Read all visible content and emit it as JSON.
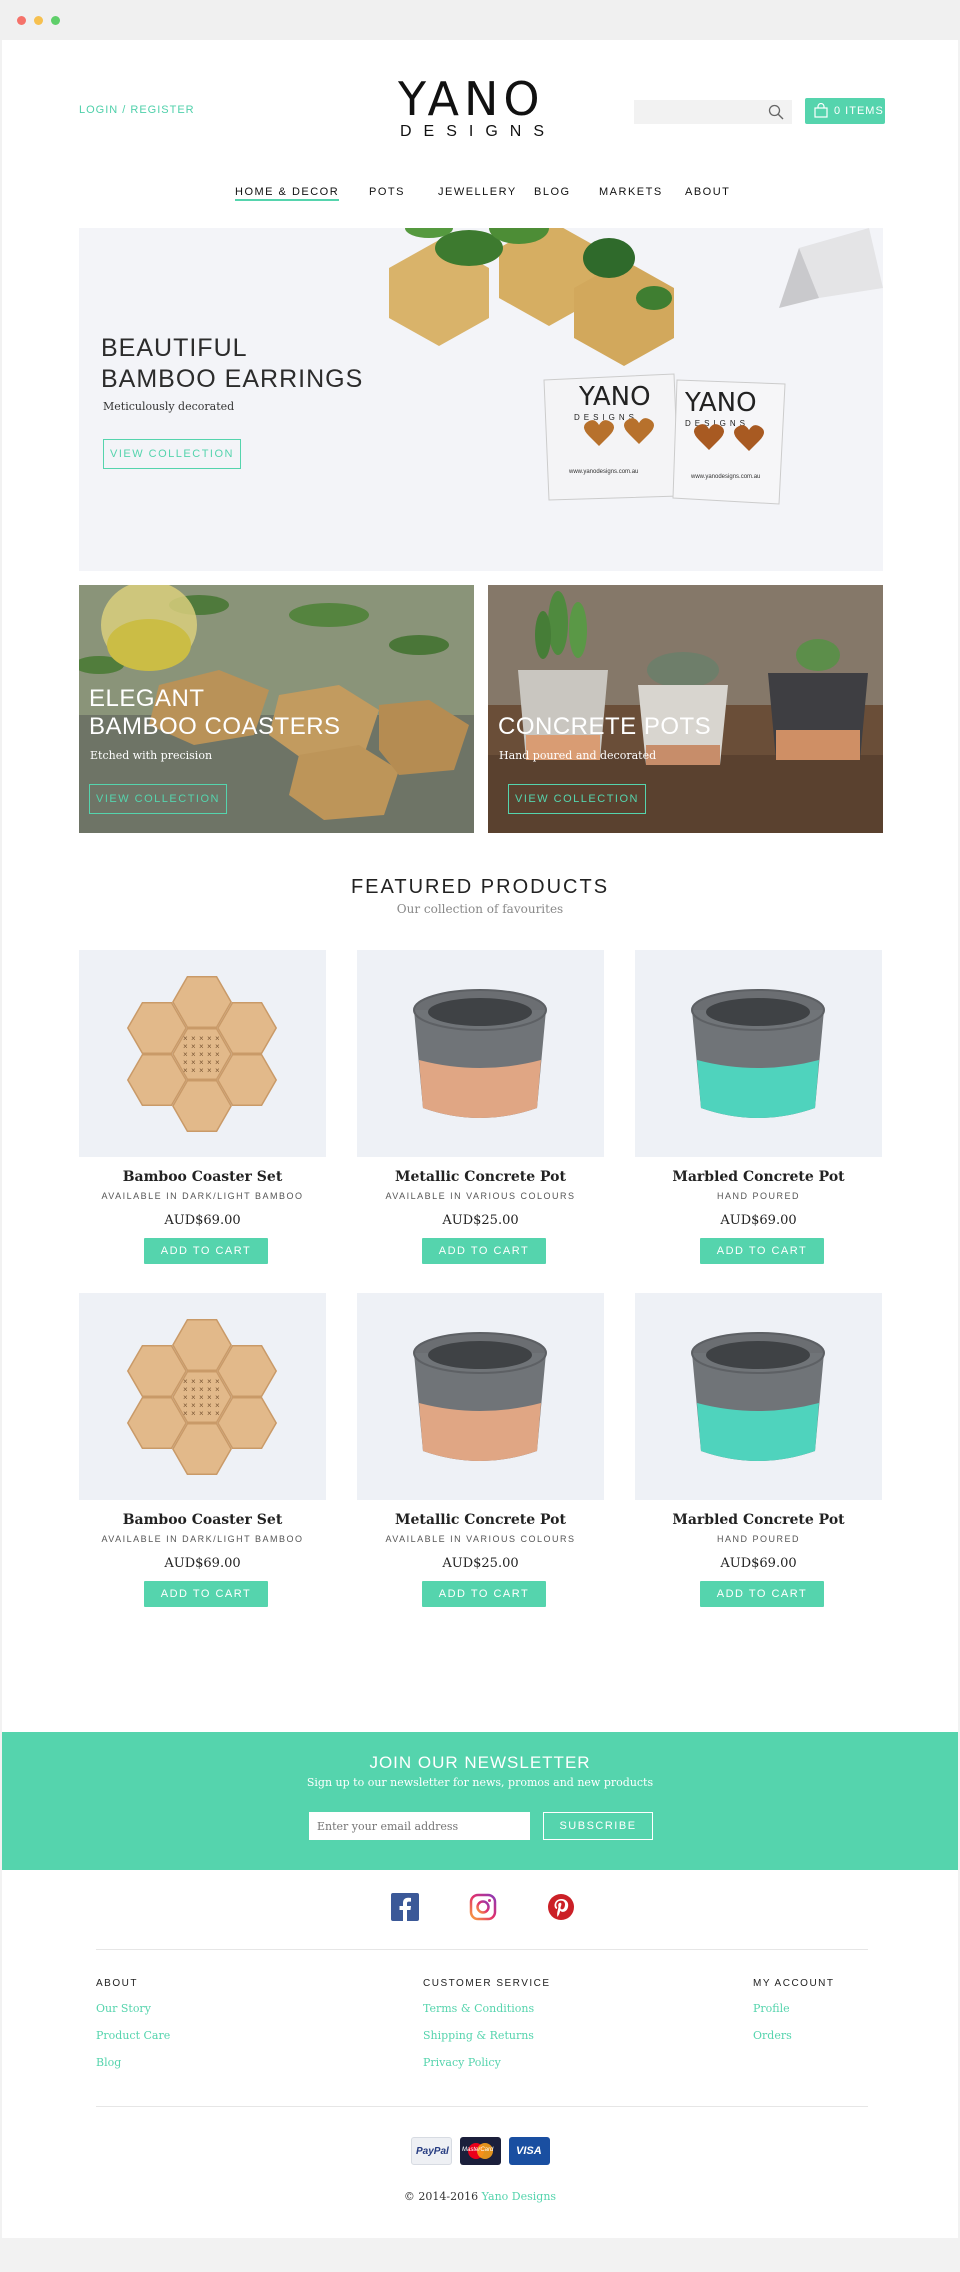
{
  "header": {
    "login_label": "LOGIN / REGISTER",
    "logo_top": "YANO",
    "logo_sub": "DESIGNS",
    "search_placeholder": "",
    "cart_label": "0 ITEMS"
  },
  "nav": [
    "HOME & DECOR",
    "POTS",
    "JEWELLERY",
    "BLOG",
    "MARKETS",
    "ABOUT"
  ],
  "hero": {
    "title_line1": "BEAUTIFUL",
    "title_line2": "BAMBOO EARRINGS",
    "subtitle": "Meticulously decorated",
    "button": "VIEW COLLECTION",
    "card_brand": "YANO",
    "card_brand_sub": "DESIGNS",
    "card_url": "www.yanodesigns.com.au"
  },
  "promos": [
    {
      "title_line1": "ELEGANT",
      "title_line2": "BAMBOO COASTERS",
      "subtitle": "Etched with precision",
      "button": "VIEW COLLECTION"
    },
    {
      "title_line1": "CONCRETE POTS",
      "subtitle": "Hand poured and decorated",
      "button": "VIEW COLLECTION"
    }
  ],
  "featured": {
    "title": "FEATURED PRODUCTS",
    "subtitle": "Our collection of favourites",
    "add_label": "ADD TO CART",
    "products": [
      {
        "name": "Bamboo Coaster Set",
        "note": "AVAILABLE IN DARK/LIGHT BAMBOO",
        "price": "AUD$69.00",
        "image": "hexagon-coaster-set"
      },
      {
        "name": "Metallic Concrete Pot",
        "note": "AVAILABLE IN VARIOUS COLOURS",
        "price": "AUD$25.00",
        "image": "concrete-pot-copper"
      },
      {
        "name": "Marbled Concrete Pot",
        "note": "HAND POURED",
        "price": "AUD$69.00",
        "image": "concrete-pot-teal"
      },
      {
        "name": "Bamboo Coaster Set",
        "note": "AVAILABLE IN DARK/LIGHT BAMBOO",
        "price": "AUD$69.00",
        "image": "hexagon-coaster-set"
      },
      {
        "name": "Metallic Concrete Pot",
        "note": "AVAILABLE IN VARIOUS COLOURS",
        "price": "AUD$25.00",
        "image": "concrete-pot-copper"
      },
      {
        "name": "Marbled Concrete Pot",
        "note": "HAND POURED",
        "price": "AUD$69.00",
        "image": "concrete-pot-teal"
      }
    ]
  },
  "newsletter": {
    "title": "JOIN OUR NEWSLETTER",
    "subtitle": "Sign up to our newsletter for news, promos and new products",
    "placeholder": "Enter your email address",
    "button": "SUBSCRIBE"
  },
  "social": [
    "facebook-icon",
    "instagram-icon",
    "pinterest-icon"
  ],
  "footer": {
    "columns": [
      {
        "heading": "ABOUT",
        "links": [
          "Our Story",
          "Product Care",
          "Blog"
        ]
      },
      {
        "heading": "CUSTOMER SERVICE",
        "links": [
          "Terms & Conditions",
          "Shipping & Returns",
          "Privacy Policy"
        ]
      },
      {
        "heading": "MY ACCOUNT",
        "links": [
          "Profile",
          "Orders"
        ]
      }
    ],
    "payments": [
      "PayPal",
      "MasterCard",
      "VISA"
    ],
    "copyright": "© 2014-2016",
    "copyright_brand": "Yano Designs"
  },
  "colors": {
    "accent": "#55d4ad",
    "dark_text": "#222222",
    "hero_bg": "#f3f4f8"
  }
}
